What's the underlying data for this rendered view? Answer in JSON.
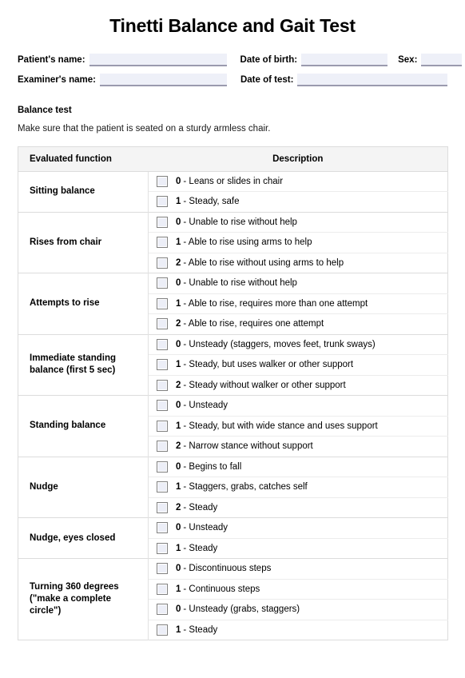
{
  "document": {
    "title": "Tinetti Balance and Gait Test"
  },
  "patient_info": {
    "fields": [
      {
        "label": "Patient's name:",
        "value": ""
      },
      {
        "label": "Date of birth:",
        "value": ""
      },
      {
        "label": "Sex:",
        "value": ""
      },
      {
        "label": "Examiner's name:",
        "value": ""
      },
      {
        "label": "Date of test:",
        "value": ""
      }
    ]
  },
  "balance_section": {
    "heading": "Balance test",
    "instruction": "Make sure that the patient is seated on a sturdy armless chair."
  },
  "table": {
    "headers": {
      "function": "Evaluated function",
      "description": "Description"
    },
    "groups": [
      {
        "function": "Sitting balance",
        "options": [
          {
            "score": "0",
            "text": "- Leans or slides in chair"
          },
          {
            "score": "1",
            "text": "- Steady, safe"
          }
        ]
      },
      {
        "function": "Rises from chair",
        "options": [
          {
            "score": "0",
            "text": "- Unable to rise without help"
          },
          {
            "score": "1",
            "text": "- Able to rise using arms to help"
          },
          {
            "score": "2",
            "text": "- Able to rise without using arms to help"
          }
        ]
      },
      {
        "function": "Attempts to rise",
        "options": [
          {
            "score": "0",
            "text": "- Unable to rise without help"
          },
          {
            "score": "1",
            "text": "- Able to rise, requires more than one attempt"
          },
          {
            "score": "2",
            "text": "- Able to rise, requires one attempt"
          }
        ]
      },
      {
        "function": "Immediate standing balance (first 5 sec)",
        "options": [
          {
            "score": "0",
            "text": "- Unsteady (staggers, moves feet, trunk sways)"
          },
          {
            "score": "1",
            "text": "- Steady, but uses walker or other support"
          },
          {
            "score": "2",
            "text": "- Steady without walker or other support"
          }
        ]
      },
      {
        "function": "Standing balance",
        "options": [
          {
            "score": "0",
            "text": "- Unsteady"
          },
          {
            "score": "1",
            "text": "- Steady, but with wide stance and uses support"
          },
          {
            "score": "2",
            "text": "- Narrow stance without support"
          }
        ]
      },
      {
        "function": "Nudge",
        "options": [
          {
            "score": "0",
            "text": "- Begins to fall"
          },
          {
            "score": "1",
            "text": "- Staggers, grabs, catches self"
          },
          {
            "score": "2",
            "text": "- Steady"
          }
        ]
      },
      {
        "function": "Nudge, eyes closed",
        "options": [
          {
            "score": "0",
            "text": "- Unsteady"
          },
          {
            "score": "1",
            "text": "- Steady"
          }
        ]
      },
      {
        "function": "Turning 360 degrees (\"make a complete circle\")",
        "options": [
          {
            "score": "0",
            "text": "- Discontinuous steps"
          },
          {
            "score": "1",
            "text": "- Continuous steps"
          },
          {
            "score": "0",
            "text": "- Unsteady (grabs, staggers)"
          },
          {
            "score": "1",
            "text": "- Steady"
          }
        ]
      }
    ]
  },
  "colors": {
    "field_fill": "#eef0f8",
    "field_underline": "#9a9aae",
    "header_bg": "#f4f4f4",
    "border": "#dcdcdc",
    "checkbox_fill": "#eceef7",
    "checkbox_border": "#808080"
  }
}
